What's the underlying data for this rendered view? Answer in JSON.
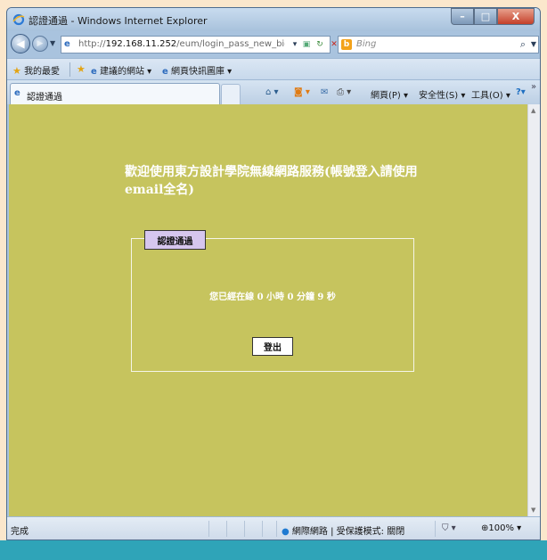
{
  "window": {
    "title": "認證通過 - Windows Internet Explorer",
    "min_label": "–",
    "max_label": "□",
    "close_label": "X"
  },
  "address_bar": {
    "url_prefix": "http://",
    "url_host": "192.168.11.252",
    "url_path": "/eum/login_pass_new_big.a"
  },
  "search": {
    "placeholder": "Bing",
    "engine_logo": "b"
  },
  "favorites_bar": {
    "favorites_label": "我的最愛",
    "suggested_sites": "建議的網站 ▾",
    "web_slice_gallery": "網頁快訊圖庫 ▾"
  },
  "tab": {
    "label": "認證通過"
  },
  "command_bar": {
    "page_menu": "網頁(P) ▾",
    "safety_menu": "安全性(S) ▾",
    "tools_menu": "工具(O) ▾",
    "more": "»"
  },
  "page": {
    "heading": "歡迎使用東方設計學院無線網路服務(帳號登入請使用email全名)",
    "legend": "認證通過",
    "online_time": "您已經在線 0 小時 0 分鐘 9 秒",
    "logout_button": "登出"
  },
  "status_bar": {
    "status": "完成",
    "zone": "網際網路 | 受保護模式: 關閉",
    "zoom": "100%"
  },
  "colors": {
    "page_background": "#c6c45e",
    "legend_background": "#d6c6ee",
    "window_frame": "#a9c3de"
  },
  "icons": [
    "ie-logo-icon",
    "back-arrow-icon",
    "forward-arrow-icon",
    "refresh-icon",
    "stop-icon",
    "search-icon",
    "favorites-star-icon",
    "home-icon",
    "feeds-icon",
    "mail-icon",
    "print-icon",
    "help-icon",
    "globe-icon",
    "zoom-icon"
  ]
}
